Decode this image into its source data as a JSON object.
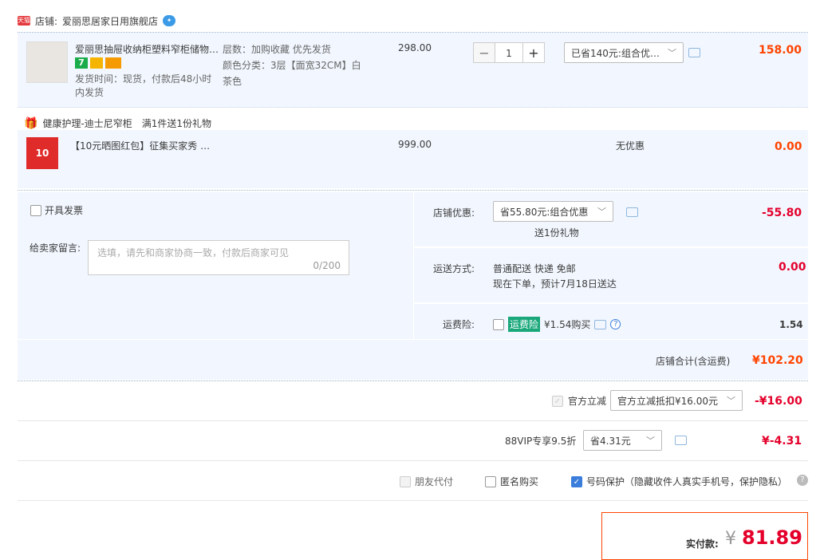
{
  "shop": {
    "badge": "天猫",
    "label": "店铺:",
    "name": "爱丽思居家日用旗舰店"
  },
  "item": {
    "title": "爱丽思抽屉收纳柜塑料窄柜储物…",
    "ship_time_line1": "发货时间：现货，付款后48小时",
    "ship_time_line2": "内发货",
    "attr_layer": "层数：加购收藏 优先发货",
    "attr_color_line1": "颜色分类：3层【面宽32CM】白",
    "attr_color_line2": "茶色",
    "unit_price": "298.00",
    "quantity": "1",
    "promo_select": "已省140元:组合优…",
    "subtotal": "158.00",
    "badge_seven": "7"
  },
  "gift": {
    "title": "健康护理-迪士尼窄柜",
    "rule": "满1件送1份礼物",
    "item_title": "【10元晒图红包】征集买家秀 …",
    "unit_price": "999.00",
    "promo": "无优惠",
    "subtotal": "0.00",
    "thumb_text": "10"
  },
  "invoice": {
    "label": "开具发票"
  },
  "message": {
    "label": "给卖家留言:",
    "placeholder": "选填，请先和商家协商一致，付款后商家可见",
    "counter": "0/200"
  },
  "shop_discount": {
    "label": "店铺优惠:",
    "select": "省55.80元:组合优惠",
    "sub": "送1份礼物",
    "value": "-55.80"
  },
  "delivery": {
    "label": "运送方式:",
    "line1": "普通配送 快递 免邮",
    "line2": "现在下单，预计7月18日送达",
    "value": "0.00"
  },
  "insurance": {
    "label": "运费险:",
    "tag": "运费险",
    "text": "¥1.54购买",
    "value": "1.54"
  },
  "shop_total": {
    "label": "店铺合计(含运费)",
    "value": "¥102.20"
  },
  "official_discount": {
    "label": "官方立减",
    "select": "官方立减抵扣¥16.00元",
    "value": "-¥16.00"
  },
  "vip": {
    "label": "88VIP专享9.5折",
    "select": "省4.31元",
    "value": "¥-4.31"
  },
  "options": {
    "friend_pay": "朋友代付",
    "anonymous": "匿名购买",
    "number_protect": "号码保护（隐藏收件人真实手机号，保护隐私）"
  },
  "final": {
    "label": "实付款:",
    "currency": "¥",
    "amount": "81.89"
  },
  "colors": {
    "accent_orange": "#ff4400",
    "accent_red": "#e4002b",
    "panel_bg": "#f2f7ff"
  }
}
